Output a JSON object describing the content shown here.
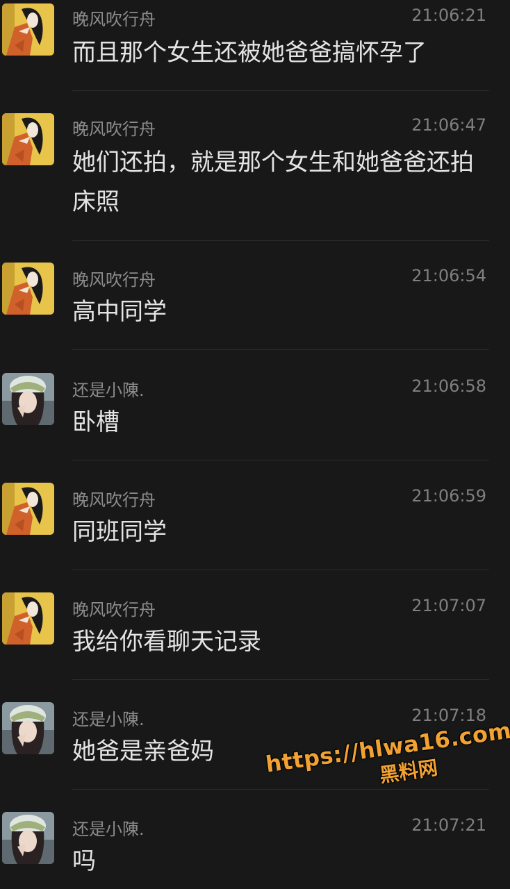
{
  "messages": [
    {
      "sender": "晚风吹行舟",
      "avatar": "cartoon-girl-avatar",
      "time": "21:06:21",
      "text": "而且那个女生还被她爸爸搞怀孕了"
    },
    {
      "sender": "晚风吹行舟",
      "avatar": "cartoon-girl-avatar",
      "time": "21:06:47",
      "text": "她们还拍，就是那个女生和她爸爸还拍床照"
    },
    {
      "sender": "晚风吹行舟",
      "avatar": "cartoon-girl-avatar",
      "time": "21:06:54",
      "text": "高中同学"
    },
    {
      "sender": "还是小陳.",
      "avatar": "photo-girl-avatar",
      "time": "21:06:58",
      "text": "卧槽"
    },
    {
      "sender": "晚风吹行舟",
      "avatar": "cartoon-girl-avatar",
      "time": "21:06:59",
      "text": "同班同学"
    },
    {
      "sender": "晚风吹行舟",
      "avatar": "cartoon-girl-avatar",
      "time": "21:07:07",
      "text": "我给你看聊天记录"
    },
    {
      "sender": "还是小陳.",
      "avatar": "photo-girl-avatar",
      "time": "21:07:18",
      "text": "她爸是亲爸妈"
    },
    {
      "sender": "还是小陳.",
      "avatar": "photo-girl-avatar",
      "time": "21:07:21",
      "text": "吗"
    }
  ],
  "watermark": {
    "url": "https://hlwa16.com",
    "name": "黑料网"
  },
  "colors": {
    "background": "#181818",
    "message_text": "#e4e4e4",
    "sender_name": "#8c8c8c",
    "timestamp": "#7f7f7f",
    "watermark": "#f2a232"
  }
}
